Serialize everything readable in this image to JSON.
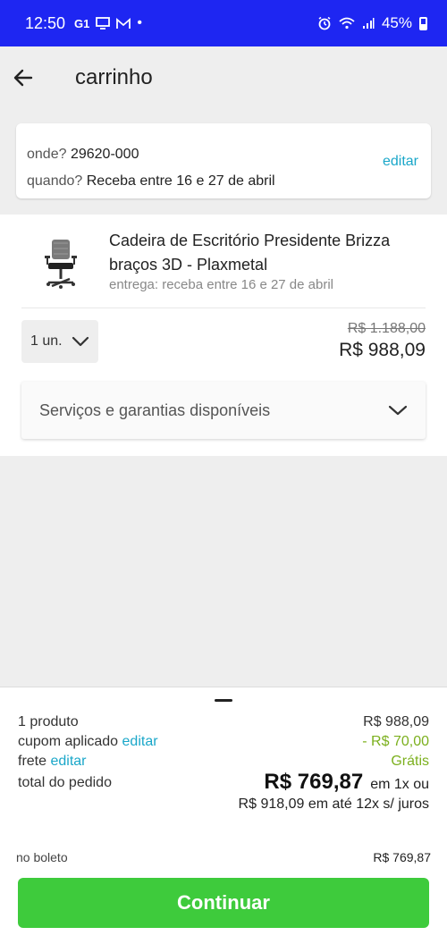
{
  "status_bar": {
    "time": "12:50",
    "battery": "45%",
    "icons": [
      "g1-icon",
      "tv-icon",
      "mail-icon",
      "dot-icon",
      "alarm-icon",
      "wifi-icon",
      "signal-icon",
      "battery-icon"
    ]
  },
  "header": {
    "title": "carrinho",
    "back_icon": "arrow-left-icon"
  },
  "delivery": {
    "where_label": "onde?",
    "where_value": "29620-000",
    "when_label": "quando?",
    "when_value": "Receba entre 16 e 27 de abril",
    "edit_label": "editar"
  },
  "product": {
    "title": "Cadeira de Escritório Presidente Brizza braços 3D - Plaxmetal",
    "delivery_text": "entrega: receba entre 16 e 27 de abril",
    "quantity": "1 un.",
    "old_price": "R$ 1.188,00",
    "price": "R$ 988,09",
    "services_label": "Serviços e garantias disponíveis"
  },
  "summary": {
    "products_label": "1 produto",
    "products_value": "R$ 988,09",
    "coupon_label": "cupom aplicado",
    "coupon_edit": "editar",
    "coupon_value": "- R$ 70,00",
    "shipping_label": "frete",
    "shipping_edit": "editar",
    "shipping_value": "Grátis",
    "total_label": "total do pedido",
    "total_value": "R$ 769,87",
    "total_suffix": "em 1x ou",
    "installments": "R$ 918,09 em até 12x s/ juros",
    "boleto_label": "no boleto",
    "boleto_value": "R$ 769,87",
    "continue_label": "Continuar"
  },
  "colors": {
    "status_bar": "#1e26f2",
    "link": "#1aa7c9",
    "discount_green": "#7cb01e",
    "button_green": "#3ecb3c"
  }
}
